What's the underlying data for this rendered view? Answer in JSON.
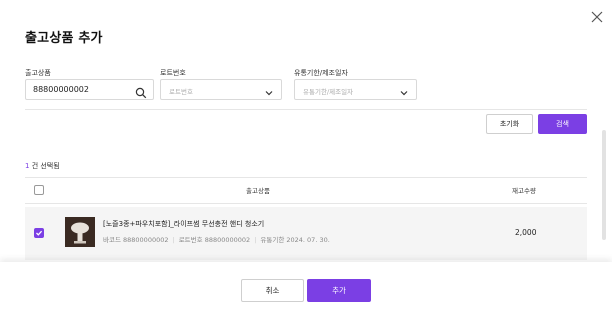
{
  "dialog": {
    "title": "출고상품 추가",
    "close_icon": "close-icon"
  },
  "filters": {
    "product": {
      "label": "출고상품",
      "value": "88800000002",
      "icon": "search-icon"
    },
    "lot": {
      "label": "로트번호",
      "placeholder": "로트번호",
      "icon": "chevron-down-icon"
    },
    "expiry": {
      "label": "유통기한/제조일자",
      "placeholder": "유통기한/제조일자",
      "icon": "chevron-down-icon"
    }
  },
  "actions": {
    "reset_label": "초기화",
    "search_label": "검색"
  },
  "selection": {
    "count": "1",
    "suffix": "건 선택됨"
  },
  "table": {
    "headers": {
      "product": "출고상품",
      "stock": "재고수량"
    },
    "rows": [
      {
        "checked": true,
        "name": "[노즐3종+파우치포함]_라이프썸 무선충전 핸디 청소기",
        "barcode": "바코드 88800000002",
        "lot": "로트번호 88800000002",
        "expiry": "유통기한 2024. 07. 30.",
        "stock": "2,000"
      }
    ]
  },
  "footer": {
    "cancel_label": "취소",
    "add_label": "추가"
  },
  "colors": {
    "accent": "#7b3fe4"
  }
}
